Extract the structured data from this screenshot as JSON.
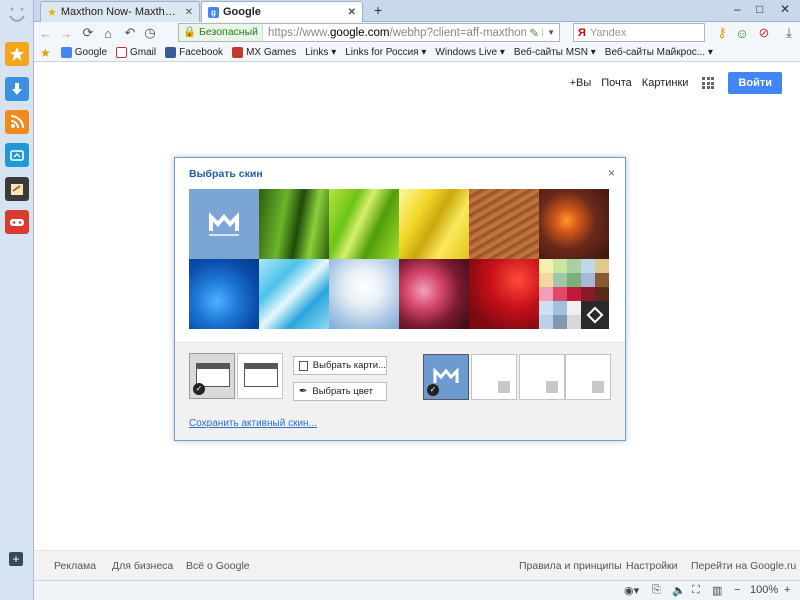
{
  "browser": {
    "tabs": [
      {
        "title": "Maxthon Now- Maxthon Start Pa...",
        "active": false
      },
      {
        "title": "Google",
        "active": true
      }
    ],
    "new_tab_symbol": "+",
    "window_controls": [
      "–",
      "□",
      "✕"
    ],
    "address": {
      "secure_label": "Безопасный",
      "url_prefix": "https://www.",
      "url_domain": "google.com",
      "url_rest": "/webhp?client=aff-maxthon-maxthon"
    },
    "search": {
      "placeholder": "Yandex"
    },
    "bookmarks": [
      {
        "label": "Google",
        "icon": "google-icon"
      },
      {
        "label": "Gmail",
        "icon": "gmail-icon"
      },
      {
        "label": "Facebook",
        "icon": "facebook-icon"
      },
      {
        "label": "MX Games",
        "icon": "mx-games-icon"
      },
      {
        "label": "Links ▾",
        "icon": ""
      },
      {
        "label": "Links for Россия ▾",
        "icon": ""
      },
      {
        "label": "Windows Live ▾",
        "icon": ""
      },
      {
        "label": "Веб-сайты MSN ▾",
        "icon": ""
      },
      {
        "label": "Веб-сайты Майкрос... ▾",
        "icon": ""
      }
    ],
    "zoom": "100%"
  },
  "google": {
    "top_links": [
      "+Вы",
      "Почта",
      "Картинки"
    ],
    "signin_label": "Войти",
    "footer_left": [
      "Реклама",
      "Для бизнеса",
      "Всё о Google"
    ],
    "footer_right": [
      "Правила и принципы",
      "Настройки",
      "Перейти на Google.ru"
    ]
  },
  "dialog": {
    "title": "Выбрать скин",
    "close_symbol": "×",
    "choose_image_label": "Выбрать карти...",
    "choose_color_label": "Выбрать цвет",
    "save_link": "Сохранить активный скин...",
    "layout_selected_index": 0,
    "swatch_selected_index": 0,
    "colors": {
      "accent": "#1f5da8",
      "link": "#2a6fc9",
      "maxthon_tile": "#6d9bcf"
    }
  }
}
